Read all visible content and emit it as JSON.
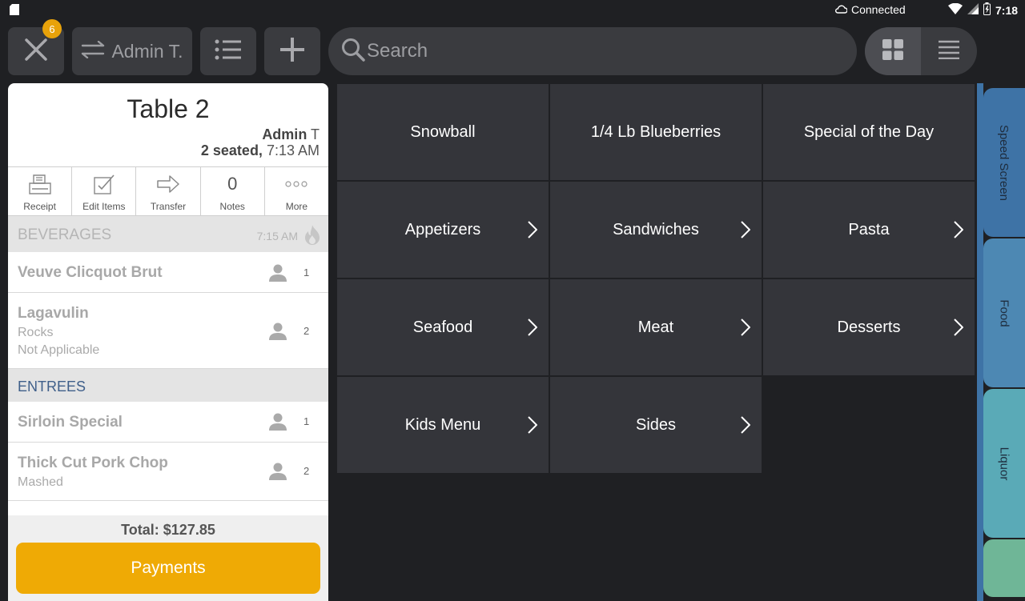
{
  "status_bar": {
    "connection": "Connected",
    "time": "7:18",
    "icons": [
      "sd-card-icon",
      "cloud-icon",
      "wifi-icon",
      "signal-icon",
      "battery-icon"
    ]
  },
  "toolbar": {
    "close_badge": "6",
    "admin_label": "Admin T.",
    "search_placeholder": "Search"
  },
  "order": {
    "table": "Table 2",
    "server": "Admin",
    "server_initial": "T",
    "seated": "2 seated,",
    "time": "7:13 AM",
    "actions": [
      {
        "label": "Receipt",
        "icon": "receipt-icon"
      },
      {
        "label": "Edit Items",
        "icon": "edit-icon"
      },
      {
        "label": "Transfer",
        "icon": "transfer-arrow-icon"
      },
      {
        "label": "Notes",
        "count": "0"
      },
      {
        "label": "More",
        "icon": "more-dots-icon"
      }
    ],
    "sections": [
      {
        "title": "BEVERAGES",
        "time": "7:15 AM",
        "items": [
          {
            "name": "Veuve Clicquot Brut",
            "seat": "1",
            "mods": []
          },
          {
            "name": "Lagavulin",
            "seat": "2",
            "mods": [
              "Rocks",
              "Not Applicable"
            ]
          }
        ]
      },
      {
        "title": "ENTREES",
        "items": [
          {
            "name": "Sirloin Special",
            "seat": "1",
            "mods": []
          },
          {
            "name": "Thick Cut Pork Chop",
            "seat": "2",
            "mods": [
              "Mashed"
            ]
          }
        ]
      }
    ],
    "total": "Total: $127.85",
    "payments_label": "Payments"
  },
  "menu_tiles": [
    {
      "label": "Snowball",
      "has_children": false
    },
    {
      "label": "1/4 Lb Blueberries",
      "has_children": false
    },
    {
      "label": "Special of the Day",
      "has_children": false
    },
    {
      "label": "Appetizers",
      "has_children": true
    },
    {
      "label": "Sandwiches",
      "has_children": true
    },
    {
      "label": "Pasta",
      "has_children": true
    },
    {
      "label": "Seafood",
      "has_children": true
    },
    {
      "label": "Meat",
      "has_children": true
    },
    {
      "label": "Desserts",
      "has_children": true
    },
    {
      "label": "Kids Menu",
      "has_children": true
    },
    {
      "label": "Sides",
      "has_children": true
    }
  ],
  "side_tabs": [
    {
      "label": "Speed Screen",
      "color": "#3e73a6"
    },
    {
      "label": "Food",
      "color": "#4d88b3"
    },
    {
      "label": "Liquor",
      "color": "#5aaab7"
    },
    {
      "label": "",
      "color": "#6fb697"
    }
  ],
  "colors": {
    "background": "#1f2023",
    "tile": "#34353a",
    "accent": "#efaa05",
    "entrees_header": "#3f5f8a"
  }
}
